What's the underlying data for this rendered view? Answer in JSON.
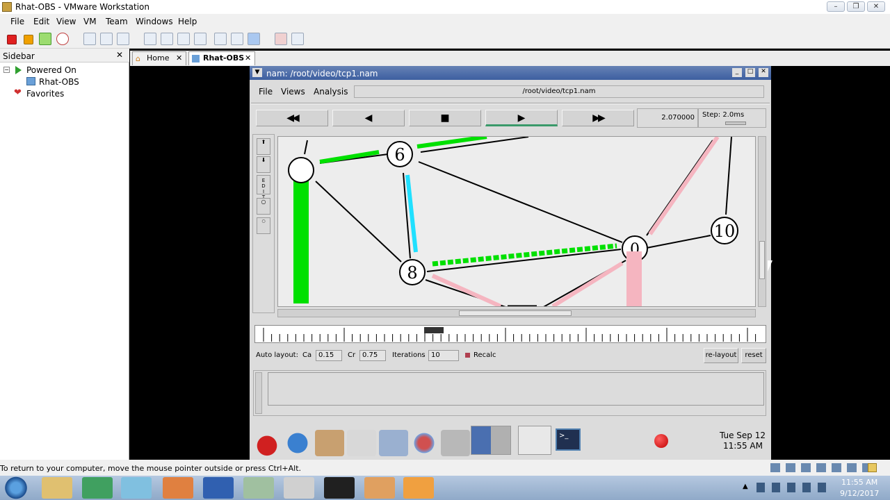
{
  "vmware": {
    "title": "Rhat-OBS - VMware Workstation",
    "menu": [
      "File",
      "Edit",
      "View",
      "VM",
      "Team",
      "Windows",
      "Help"
    ],
    "sidebar": {
      "header": "Sidebar",
      "items": [
        {
          "label": "Powered On"
        },
        {
          "label": "Rhat-OBS"
        },
        {
          "label": "Favorites"
        }
      ]
    },
    "tabs": [
      {
        "label": "Home"
      },
      {
        "label": "Rhat-OBS"
      }
    ],
    "status_text": "To return to your computer, move the mouse pointer outside or press Ctrl+Alt."
  },
  "nam": {
    "title": "nam: /root/video/tcp1.nam",
    "menu": [
      "File",
      "Views",
      "Analysis"
    ],
    "file_path": "/root/video/tcp1.nam",
    "playback": {
      "rewind_fast": "◀◀",
      "rewind": "◀",
      "stop": "■",
      "play": "▶",
      "forward_fast": "▶▶"
    },
    "time": "2.070000",
    "step": "Step: 2.0ms",
    "nodes": [
      "6",
      "8",
      "10",
      "0"
    ],
    "edit_tool": "E\nD\nI\nT",
    "auto_layout": {
      "label": "Auto layout:",
      "ca_label": "Ca",
      "ca_value": "0.15",
      "cr_label": "Cr",
      "cr_value": "0.75",
      "iterations_label": "Iterations",
      "iterations_value": "10",
      "recalc_label": "Recalc",
      "relayout": "re-layout",
      "reset": "reset"
    }
  },
  "guest_panel": {
    "date": "Tue Sep 12",
    "time": "11:55 AM"
  },
  "windows_taskbar": {
    "time": "11:55 AM",
    "date": "9/12/2017"
  },
  "colors": {
    "green_flow": "#00e000",
    "cyan_flow": "#20e0ff",
    "pink_flow": "#f5b5c0",
    "nam_title": "#3d5fa0"
  }
}
